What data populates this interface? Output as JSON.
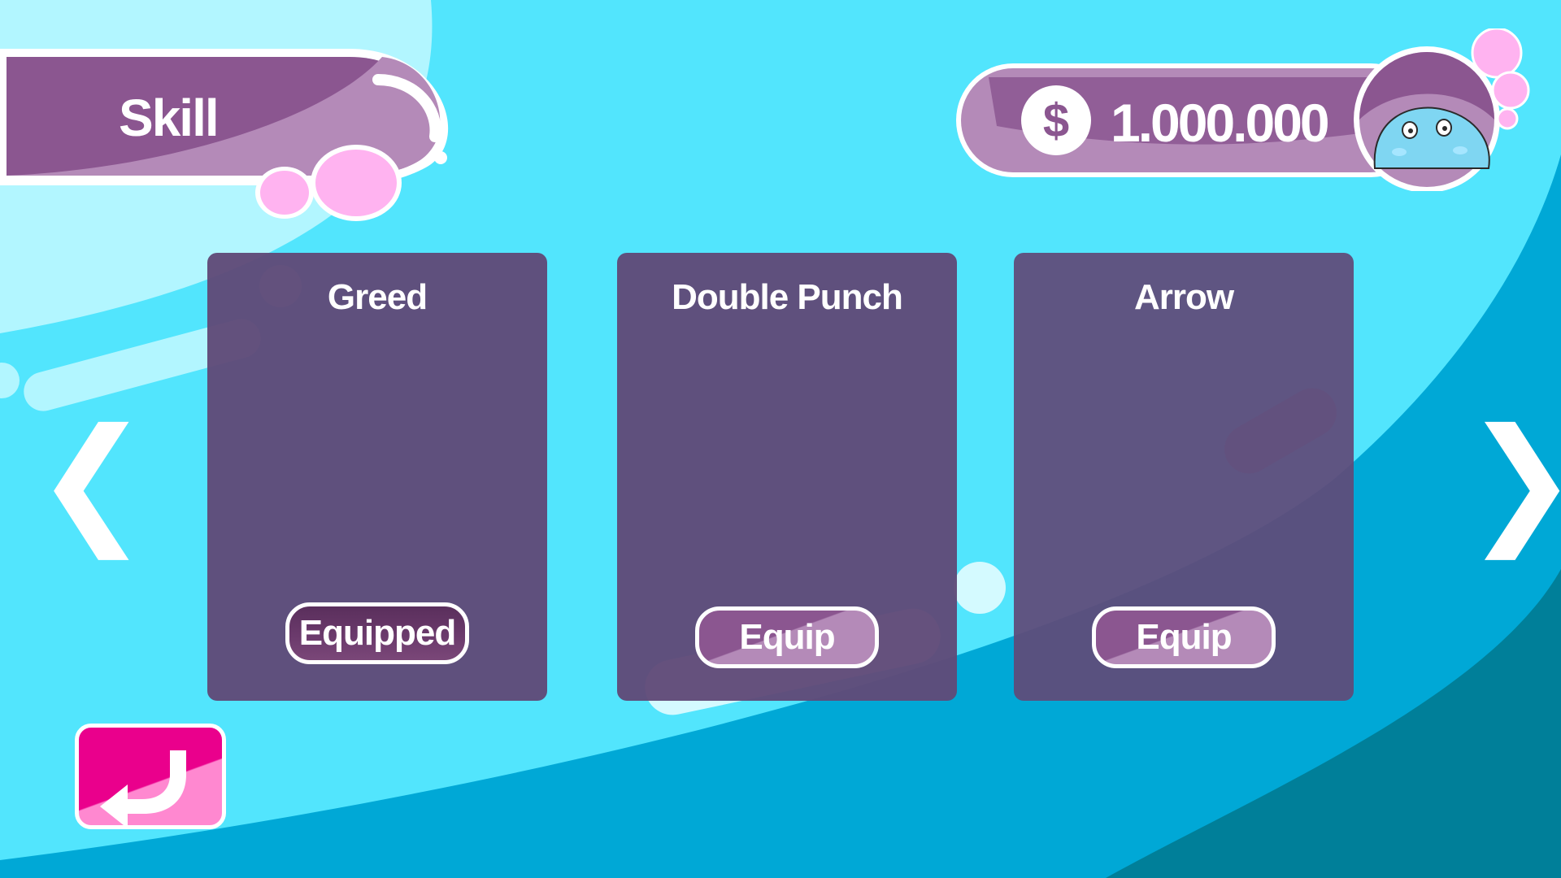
{
  "screen": {
    "title": "Skill",
    "currency_symbol": "$",
    "currency_amount": "1.000.000"
  },
  "skills": [
    {
      "name": "Greed",
      "button_label": "Equipped",
      "state": "equipped"
    },
    {
      "name": "Double Punch",
      "button_label": "Equip",
      "state": "available"
    },
    {
      "name": "Arrow",
      "button_label": "Equip",
      "state": "available"
    }
  ],
  "navigation": {
    "prev_glyph": "❮",
    "next_glyph": "❯"
  },
  "colors": {
    "sky": "#52e5fd",
    "sea": "#00a8d6",
    "deep_sea": "#007f99",
    "banner_purple": "#8b5690",
    "card": "#604a78",
    "back_button": "#ea008c",
    "bubble_pink": "#ffb3f0"
  },
  "icons": {
    "coin": "dollar-coin-icon",
    "back": "return-arrow-icon",
    "mascot": "blue-slime-mascot"
  }
}
